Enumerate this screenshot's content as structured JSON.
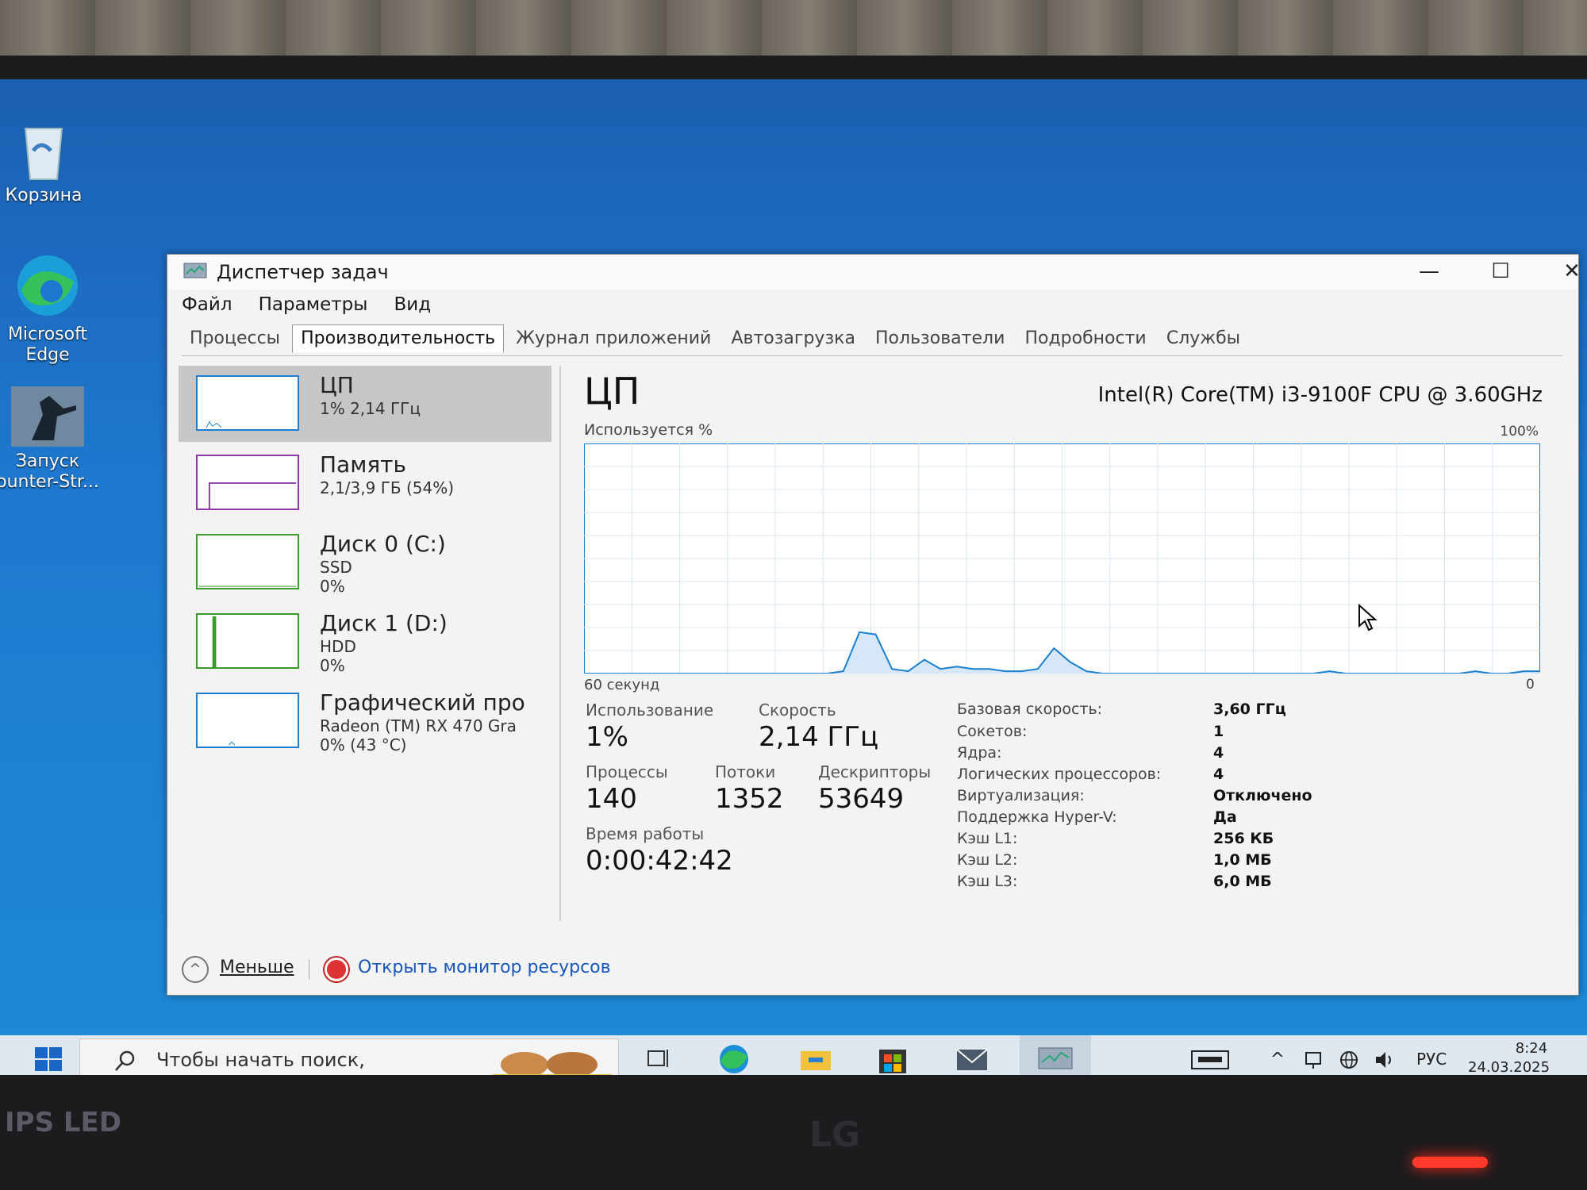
{
  "desktop": {
    "icons": [
      {
        "label": "Корзина"
      },
      {
        "label": "Microsoft Edge"
      },
      {
        "label": "Запуск",
        "label2": "ounter-Str..."
      }
    ]
  },
  "window": {
    "title": "Диспетчер задач",
    "controls": {
      "minimize": "—",
      "maximize": "☐",
      "close": "✕"
    }
  },
  "menu": [
    "Файл",
    "Параметры",
    "Вид"
  ],
  "tabs": [
    {
      "label": "Процессы",
      "active": false
    },
    {
      "label": "Производительность",
      "active": true
    },
    {
      "label": "Журнал приложений",
      "active": false
    },
    {
      "label": "Автозагрузка",
      "active": false
    },
    {
      "label": "Пользователи",
      "active": false
    },
    {
      "label": "Подробности",
      "active": false
    },
    {
      "label": "Службы",
      "active": false
    }
  ],
  "perf_list": [
    {
      "name": "ЦП",
      "line1": "1% 2,14 ГГц",
      "line2": "",
      "color": "#1a7fd0",
      "selected": true
    },
    {
      "name": "Память",
      "line1": "2,1/3,9 ГБ (54%)",
      "line2": "",
      "color": "#8b3aa8",
      "selected": false
    },
    {
      "name": "Диск 0 (C:)",
      "line1": "SSD",
      "line2": "0%",
      "color": "#3a9a2a",
      "selected": false
    },
    {
      "name": "Диск 1 (D:)",
      "line1": "HDD",
      "line2": "0%",
      "color": "#3a9a2a",
      "selected": false
    },
    {
      "name": "Графический про",
      "line1": "Radeon (TM) RX 470 Gra",
      "line2": "0% (43 °C)",
      "color": "#1a7fd0",
      "selected": false
    }
  ],
  "cpu": {
    "title": "ЦП",
    "model": "Intel(R) Core(TM) i3-9100F CPU @ 3.60GHz",
    "usage_label": "Используется %",
    "max_label": "100%",
    "time_label": "60 секунд",
    "zero_label": "0",
    "graph_color": "#1a7fd0",
    "utilization_series_percent": [
      0,
      0,
      0,
      0,
      0,
      0,
      0,
      0,
      0,
      0,
      0,
      0,
      0,
      0,
      0,
      0,
      1,
      18,
      17,
      2,
      1,
      6,
      2,
      3,
      2,
      2,
      1,
      1,
      2,
      11,
      5,
      1,
      0,
      0,
      0,
      0,
      0,
      0,
      0,
      0,
      0,
      0,
      0,
      0,
      0,
      0,
      1,
      0,
      0,
      0,
      0,
      0,
      0,
      0,
      0,
      1,
      0,
      0,
      1,
      1
    ],
    "stats": {
      "usage_label": "Использование",
      "usage_value": "1%",
      "speed_label": "Скорость",
      "speed_value": "2,14 ГГц",
      "procs_label": "Процессы",
      "procs_value": "140",
      "threads_label": "Потоки",
      "threads_value": "1352",
      "handles_label": "Дескрипторы",
      "handles_value": "53649",
      "uptime_label": "Время работы",
      "uptime_value": "0:00:42:42"
    },
    "details": [
      {
        "key": "Базовая скорость:",
        "value": "3,60 ГГц"
      },
      {
        "key": "Сокетов:",
        "value": "1"
      },
      {
        "key": "Ядра:",
        "value": "4"
      },
      {
        "key": "Логических процессоров:",
        "value": "4"
      },
      {
        "key": "Виртуализация:",
        "value": "Отключено"
      },
      {
        "key": "Поддержка Hyper-V:",
        "value": "Да"
      },
      {
        "key": "Кэш L1:",
        "value": "256 КБ"
      },
      {
        "key": "Кэш L2:",
        "value": "1,0 МБ"
      },
      {
        "key": "Кэш L3:",
        "value": "6,0 МБ"
      }
    ]
  },
  "footer": {
    "less": "Меньше",
    "resmon": "Открыть монитор ресурсов"
  },
  "taskbar": {
    "search_placeholder": "Чтобы начать поиск,",
    "lang": "РУС",
    "time": "8:24",
    "date": "24.03.2025"
  },
  "monitor": {
    "label": "IPS LED",
    "brand": "LG"
  }
}
